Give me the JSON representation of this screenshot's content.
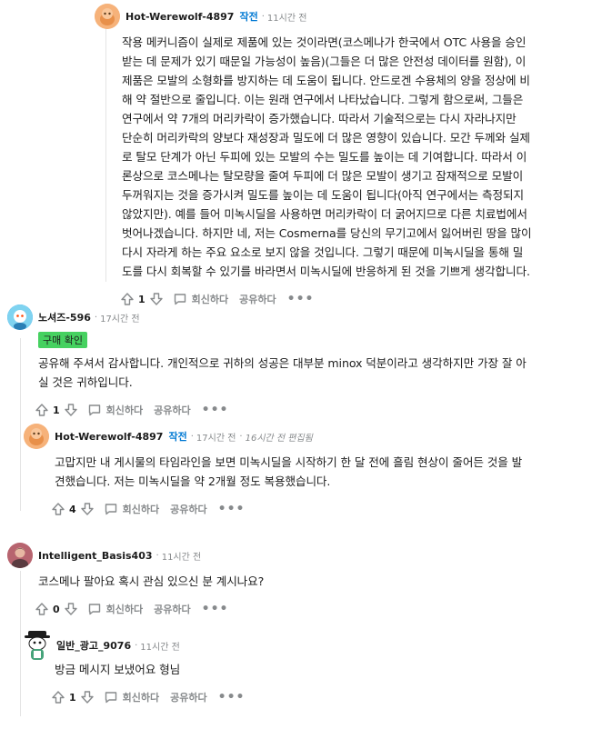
{
  "comments": [
    {
      "author": "Hot-Werewolf-4897",
      "op_label": "작전",
      "time": "11시간 전",
      "lines": [
        "작용 메커니즘이 실제로 제품에 있는 것이라면(코스메나가 한국에서 OTC 사용을 승인",
        "받는 데 문제가 있기 때문일 가능성이 높음)(그들은 더 많은 안전성 데이터를 원함), 이",
        "제품은 모발의 소형화를 방지하는 데 도움이 됩니다. 안드로겐 수용체의 양을 정상에 비",
        "해 약 절반으로 줄입니다. 이는 원래 연구에서 나타났습니다. 그렇게 함으로써, 그들은",
        "연구에서 약 7개의 머리카락이 증가했습니다. 따라서 기술적으로는 다시 자라나지만",
        "단순히 머리카락의 양보다 재성장과 밀도에 더 많은 영향이 있습니다. 모간 두께와 실제",
        "로 탈모 단계가 아닌 두피에 있는 모발의 수는 밀도를 높이는 데 기여합니다. 따라서 이",
        "론상으로 코스메나는 탈모량을 줄여 두피에 더 많은 모발이 생기고 잠재적으로 모발이",
        "두꺼워지는 것을 증가시켜 밀도를 높이는 데 도움이 됩니다(아직 연구에서는 측정되지",
        "않았지만). 예를 들어 미녹시딜을 사용하면 머리카락이 더 굵어지므로 다른 치료법에서",
        "벗어나겠습니다. 하지만 네, 저는 Cosmerna를 당신의 무기고에서 잃어버린 땅을 많이",
        "다시 자라게 하는 주요 요소로 보지 않을 것입니다. 그렇기 때문에 미녹시딜을 통해 밀",
        "도를 다시 회복할 수 있기를 바라면서 미녹시딜에 반응하게 된 것을 기쁘게 생각합니다."
      ],
      "votes": "1",
      "reply_label": "회신하다",
      "share_label": "공유하다",
      "more_label": "•••"
    },
    {
      "author": "노셔즈-596",
      "time": "17시간 전",
      "flair": "구매 확인",
      "lines": [
        "공유해 주셔서 감사합니다. 개인적으로 귀하의 성공은 대부분 minox 덕분이라고 생각하지만 가장 잘 아",
        "실 것은 귀하입니다."
      ],
      "votes": "1",
      "reply_label": "회신하다",
      "share_label": "공유하다",
      "more_label": "•••"
    },
    {
      "author": "Hot-Werewolf-4897",
      "op_label": "작전",
      "time": "17시간 전",
      "edited": "16시간 전 편집됨",
      "lines": [
        "고맙지만 내 게시물의 타임라인을 보면 미녹시딜을 시작하기 한 달 전에 흘림 현상이 줄어든 것을 발",
        "견했습니다. 저는 미녹시딜을 약 2개월 정도 복용했습니다."
      ],
      "votes": "4",
      "reply_label": "회신하다",
      "share_label": "공유하다",
      "more_label": "•••"
    },
    {
      "author": "Intelligent_Basis403",
      "time": "11시간 전",
      "lines": [
        "코스메나 팔아요 혹시 관심 있으신 분 계시나요?"
      ],
      "votes": "0",
      "reply_label": "회신하다",
      "share_label": "공유하다",
      "more_label": "•••"
    },
    {
      "author": "일반_광고_9076",
      "time": "11시간 전",
      "lines": [
        "방금 메시지 보냈어요 형님"
      ],
      "votes": "1",
      "reply_label": "회신하다",
      "share_label": "공유하다",
      "more_label": "•••"
    }
  ],
  "colors": {
    "op_tag": "#0079d3",
    "flair_bg": "#46d160",
    "meta": "#878a8c",
    "thread_line": "#e4e4e4"
  },
  "icons": [
    "upvote-icon",
    "downvote-icon",
    "reply-icon",
    "more-icon"
  ]
}
